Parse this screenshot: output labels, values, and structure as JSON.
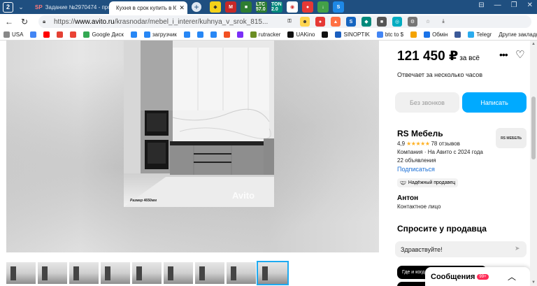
{
  "browser": {
    "tab_count": "2",
    "tabs": [
      {
        "title": "Задание №2970474 - про",
        "favicon": "SP"
      },
      {
        "title": "Кухня в срок купить в К"
      }
    ],
    "new_tab": "+",
    "url_prefix": "https://",
    "url_domain": "www.avito.ru",
    "url_path": "/krasnodar/mebel_i_interer/kuhnya_v_srok_815...",
    "extensions": [
      "M",
      "LTC 57.0",
      "TON 2.0"
    ],
    "bookmarks": [
      {
        "label": "USA",
        "color": "#888888"
      },
      {
        "label": "",
        "color": "#4285f4"
      },
      {
        "label": "",
        "color": "#ff0000"
      },
      {
        "label": "",
        "color": "#e44134"
      },
      {
        "label": "",
        "color": "#ea4335"
      },
      {
        "label": "Google Диск",
        "color": "#34a853"
      },
      {
        "label": "",
        "color": "#2787f5"
      },
      {
        "label": "загрузчик",
        "color": "#2787f5"
      },
      {
        "label": "",
        "color": "#2787f5"
      },
      {
        "label": "",
        "color": "#2787f5"
      },
      {
        "label": "",
        "color": "#2787f5"
      },
      {
        "label": "",
        "color": "#f25022"
      },
      {
        "label": "",
        "color": "#7b2ff7"
      },
      {
        "label": "rutracker",
        "color": "#6b8e23"
      },
      {
        "label": "UAKino",
        "color": "#111111"
      },
      {
        "label": "",
        "color": "#111111"
      },
      {
        "label": "SINOPTIK",
        "color": "#1b5fbf"
      },
      {
        "label": "btc to $",
        "color": "#4285f4"
      },
      {
        "label": "",
        "color": "#f4a300"
      },
      {
        "label": "Обмін",
        "color": "#1a73e8"
      },
      {
        "label": "",
        "color": "#3b5998"
      },
      {
        "label": "Telegr",
        "color": "#2aabee"
      }
    ],
    "other_bookmarks": "Другие закладки"
  },
  "gallery": {
    "photo_caption": "Размер 4650мм",
    "watermark": "Avito",
    "thumbnail_count": 9,
    "selected_thumbnail": 9
  },
  "sidebar": {
    "price": "121 450 ₽",
    "price_suffix": "за всё",
    "reply_time": "Отвечает за несколько часов",
    "btn_nocall": "Без звонков",
    "btn_write": "Написать",
    "seller_name": "RS Мебель",
    "rating_value": "4,9",
    "stars": "★★★★★",
    "reviews": "78 отзывов",
    "company": "Компания · На Авито с 2024 года",
    "ads_count": "22 объявления",
    "subscribe": "Подписаться",
    "seller_logo": "RS МЕБЕЛЬ",
    "reliable_seller": "Надёжный продавец",
    "contact_name": "Антон",
    "contact_role": "Контактное лицо",
    "ask_title": "Спросите у продавца",
    "ask_input": "Здравствуйте!",
    "quick_question_1": "Где и когда можно посмотреть?"
  },
  "messages": {
    "label": "Сообщения",
    "badge": "99+"
  },
  "colors": {
    "accent": "#00aaff",
    "link": "#1a6fd6",
    "tabbar": "#1f4f80",
    "badge": "#ff2a55"
  }
}
